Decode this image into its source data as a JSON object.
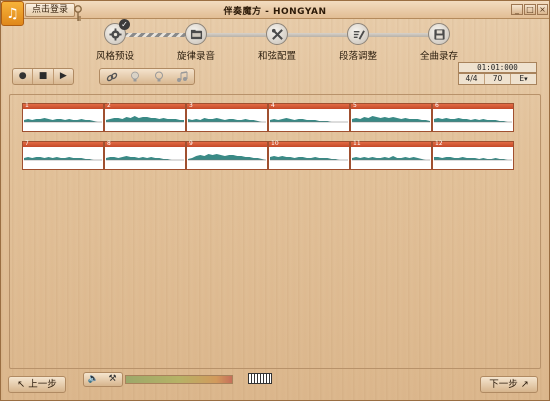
{
  "window": {
    "title": "伴奏魔方 - HONGYAN",
    "controls": [
      "_",
      "□",
      "×"
    ]
  },
  "login": {
    "label": "点击登录"
  },
  "steps": [
    {
      "label": "风格预设",
      "icon": "gear-icon",
      "done": true
    },
    {
      "label": "旋律录音",
      "icon": "folder-icon"
    },
    {
      "label": "和弦配置",
      "icon": "tools-icon"
    },
    {
      "label": "段落调整",
      "icon": "edit-icon"
    },
    {
      "label": "全曲录存",
      "icon": "save-icon"
    }
  ],
  "transport": {
    "record": "●",
    "stop": "■",
    "play": "▶"
  },
  "tools": [
    "link-icon",
    "bulb-icon",
    "bulb-outline-icon",
    "notes-icon"
  ],
  "status": {
    "time": "01:01:000",
    "meter": "4/4",
    "tempo": "70",
    "key": "E",
    "key_arrow": "▾"
  },
  "tracks": {
    "row1": [
      {
        "num": "1",
        "wave": [
          2,
          3,
          2,
          3,
          3,
          4,
          3,
          2,
          3,
          3,
          2,
          3,
          2,
          2,
          3,
          2,
          2,
          1,
          0,
          0
        ]
      },
      {
        "num": "2",
        "wave": [
          2,
          3,
          4,
          4,
          3,
          5,
          4,
          6,
          4,
          5,
          5,
          4,
          4,
          3,
          4,
          3,
          3,
          3,
          2,
          2
        ]
      },
      {
        "num": "3",
        "wave": [
          3,
          2,
          3,
          2,
          4,
          3,
          3,
          4,
          3,
          2,
          3,
          3,
          2,
          2,
          3,
          2,
          2,
          1,
          0,
          0
        ]
      },
      {
        "num": "4",
        "wave": [
          2,
          3,
          2,
          3,
          4,
          3,
          2,
          3,
          3,
          2,
          2,
          2,
          1,
          1,
          1,
          0,
          0,
          0,
          0,
          0
        ]
      },
      {
        "num": "5",
        "wave": [
          3,
          4,
          3,
          5,
          4,
          6,
          5,
          4,
          5,
          4,
          5,
          4,
          3,
          4,
          3,
          3,
          3,
          2,
          2,
          1
        ]
      },
      {
        "num": "6",
        "wave": [
          3,
          4,
          3,
          4,
          3,
          3,
          4,
          3,
          3,
          2,
          3,
          2,
          3,
          2,
          2,
          2,
          1,
          1,
          0,
          0
        ]
      }
    ],
    "row2": [
      {
        "num": "7",
        "wave": [
          2,
          3,
          2,
          3,
          3,
          2,
          3,
          2,
          3,
          2,
          2,
          3,
          2,
          2,
          2,
          1,
          1,
          0,
          0,
          0
        ]
      },
      {
        "num": "8",
        "wave": [
          2,
          3,
          3,
          2,
          3,
          4,
          3,
          3,
          2,
          3,
          2,
          3,
          2,
          2,
          1,
          1,
          0,
          0,
          0,
          0
        ]
      },
      {
        "num": "9",
        "wave": [
          1,
          2,
          4,
          5,
          4,
          6,
          5,
          6,
          5,
          4,
          5,
          5,
          4,
          4,
          3,
          3,
          2,
          2,
          1,
          0
        ]
      },
      {
        "num": "10",
        "wave": [
          3,
          4,
          3,
          4,
          3,
          3,
          2,
          3,
          3,
          2,
          2,
          3,
          2,
          2,
          2,
          1,
          1,
          0,
          0,
          0
        ]
      },
      {
        "num": "11",
        "wave": [
          2,
          3,
          2,
          3,
          2,
          3,
          2,
          2,
          3,
          2,
          4,
          2,
          2,
          3,
          2,
          3,
          2,
          1,
          0,
          0
        ]
      },
      {
        "num": "12",
        "wave": [
          3,
          3,
          2,
          3,
          3,
          2,
          2,
          3,
          2,
          2,
          2,
          1,
          2,
          1,
          1,
          2,
          1,
          1,
          0,
          0
        ]
      }
    ]
  },
  "footer": {
    "prev_label": "上一步",
    "next_label": "下一步",
    "volume_icon": "speaker-icon",
    "mute_icon": "brush-icon",
    "level": 0.85,
    "piano_icon": "piano-keyboard-icon"
  },
  "colors": {
    "wave": "#3a8a86",
    "clip_header": "#d5583a",
    "wood": "#dfbd95"
  }
}
